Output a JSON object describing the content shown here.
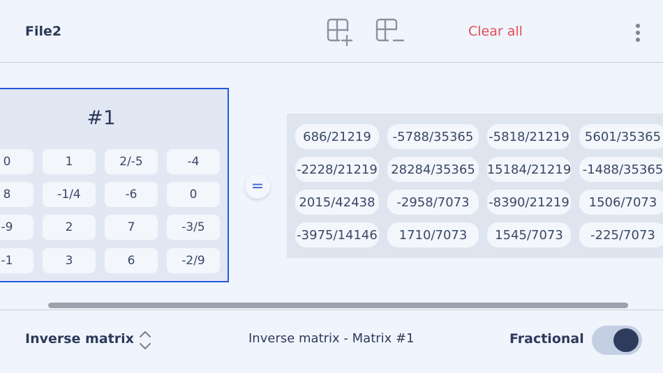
{
  "header": {
    "file_name": "File2",
    "add_matrix_icon": "grid-plus-icon",
    "remove_matrix_icon": "grid-minus-icon",
    "clear_all_label": "Clear all",
    "more_icon": "more-vertical-icon"
  },
  "matrix": {
    "title": "#1",
    "rows": [
      [
        "0",
        "1",
        "2/-5",
        "-4"
      ],
      [
        "8",
        "-1/4",
        "-6",
        "0"
      ],
      [
        "-9",
        "2",
        "7",
        "-3/5"
      ],
      [
        "-1",
        "3",
        "6",
        "-2/9"
      ]
    ]
  },
  "equals_label": "=",
  "result": {
    "rows": [
      [
        "686/21219",
        "-5788/35365",
        "-5818/21219",
        "5601/35365"
      ],
      [
        "-2228/21219",
        "28284/35365",
        "15184/21219",
        "-1488/35365"
      ],
      [
        "2015/42438",
        "-2958/7073",
        "-8390/21219",
        "1506/7073"
      ],
      [
        "-3975/14146",
        "1710/7073",
        "1545/7073",
        "-225/7073"
      ]
    ]
  },
  "footer": {
    "operation_label": "Inverse matrix",
    "description": "Inverse matrix - Matrix #1",
    "fractional_label": "Fractional",
    "fractional_on": true
  },
  "colors": {
    "accent_blue": "#2457dd",
    "danger_red": "#e24f56",
    "text_dark": "#2d3a5c"
  }
}
